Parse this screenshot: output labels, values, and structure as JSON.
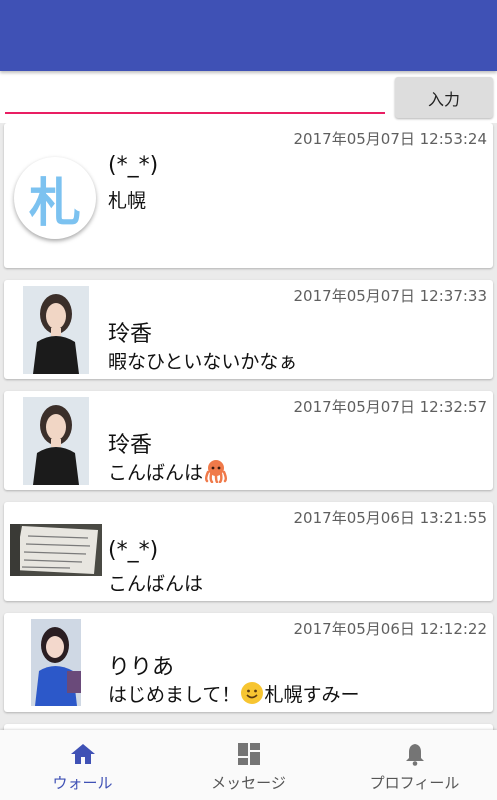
{
  "input": {
    "placeholder": "",
    "value": ""
  },
  "submit_label": "入力",
  "posts": [
    {
      "time": "2017年05月07日 12:53:24",
      "name": "(*_*)",
      "text": "札幌",
      "avatar_char": "札"
    },
    {
      "time": "2017年05月07日 12:37:33",
      "name": "玲香",
      "text": "暇なひといないかなぁ"
    },
    {
      "time": "2017年05月07日 12:32:57",
      "name": "玲香",
      "text": "こんばんは"
    },
    {
      "time": "2017年05月06日 13:21:55",
      "name": "(*_*)",
      "text": "こんばんは"
    },
    {
      "time": "2017年05月06日 12:12:22",
      "name": "りりあ",
      "text_a": "はじめまして！",
      "text_b": "札幌すみー"
    }
  ],
  "nav": [
    {
      "label": "ウォール",
      "icon": "home-icon",
      "active": true
    },
    {
      "label": "メッセージ",
      "icon": "dashboard-icon",
      "active": false
    },
    {
      "label": "プロフィール",
      "icon": "bell-icon",
      "active": false
    }
  ],
  "colors": {
    "primary": "#3f51b5",
    "accent": "#e91e63"
  }
}
